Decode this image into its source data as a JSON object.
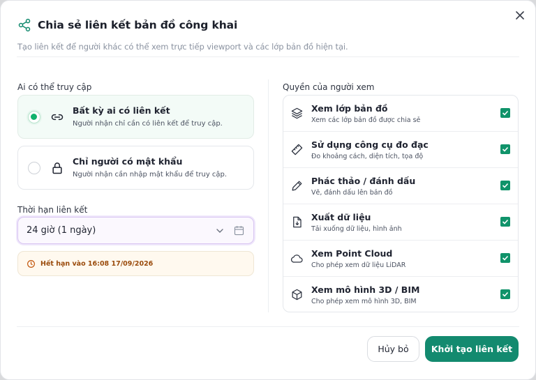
{
  "dialog": {
    "title": "Chia sẻ liên kết bản đồ công khai",
    "subtitle": "Tạo liên kết để người khác có thể xem trực tiếp viewport và các lớp bản đồ hiện tại."
  },
  "access": {
    "label": "Ai có thể truy cập",
    "options": [
      {
        "title": "Bất kỳ ai có liên kết",
        "desc": "Người nhận chỉ cần có liên kết để truy cập.",
        "selected": true,
        "icon": "link-icon"
      },
      {
        "title": "Chỉ người có mật khẩu",
        "desc": "Người nhận cần nhập mật khẩu để truy cập.",
        "selected": false,
        "icon": "lock-icon"
      }
    ]
  },
  "expiration": {
    "label": "Thời hạn liên kết",
    "value": "24 giờ (1 ngày)",
    "notice": "Hết hạn vào 16:08 17/09/2026"
  },
  "permissions": {
    "label": "Quyền của người xem",
    "items": [
      {
        "title": "Xem lớp bản đồ",
        "desc": "Xem các lớp bản đồ được chia sẻ",
        "checked": true,
        "icon": "layers-icon"
      },
      {
        "title": "Sử dụng công cụ đo đạc",
        "desc": "Đo khoảng cách, diện tích, tọa độ",
        "checked": true,
        "icon": "ruler-icon"
      },
      {
        "title": "Phác thảo / đánh dấu",
        "desc": "Vẽ, đánh dấu lên bản đồ",
        "checked": true,
        "icon": "pencil-icon"
      },
      {
        "title": "Xuất dữ liệu",
        "desc": "Tải xuống dữ liệu, hình ảnh",
        "checked": true,
        "icon": "file-download-icon"
      },
      {
        "title": "Xem Point Cloud",
        "desc": "Cho phép xem dữ liệu LiDAR",
        "checked": true,
        "icon": "cloud-icon"
      },
      {
        "title": "Xem mô hình 3D / BIM",
        "desc": "Cho phép xem mô hình 3D, BIM",
        "checked": true,
        "icon": "cube-icon"
      }
    ]
  },
  "footer": {
    "cancel_label": "Hủy bỏ",
    "create_label": "Khởi tạo liên kết"
  },
  "colors": {
    "accent": "#138a6f",
    "radio_on": "#10b26c",
    "warning_text": "#9a4b0c"
  }
}
